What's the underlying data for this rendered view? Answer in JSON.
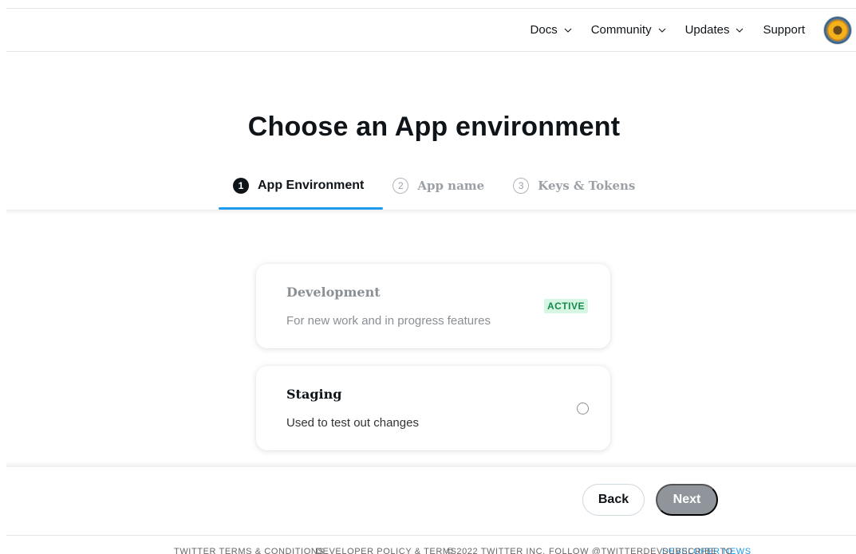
{
  "nav": {
    "items": [
      {
        "label": "Docs",
        "has_dropdown": true
      },
      {
        "label": "Community",
        "has_dropdown": true
      },
      {
        "label": "Updates",
        "has_dropdown": true
      },
      {
        "label": "Support",
        "has_dropdown": false
      }
    ]
  },
  "page_title": "Choose an App environment",
  "steps": [
    {
      "number": "1",
      "label": "App Environment",
      "state": "active"
    },
    {
      "number": "2",
      "label": "App name",
      "state": "inactive"
    },
    {
      "number": "3",
      "label": "Keys & Tokens",
      "state": "inactive"
    }
  ],
  "environments": [
    {
      "title": "Development",
      "description": "For new work and in progress features",
      "badge": "ACTIVE",
      "state": "disabled"
    },
    {
      "title": "Staging",
      "description": "Used to test out changes",
      "selected": false
    }
  ],
  "actions": {
    "back_label": "Back",
    "next_label": "Next"
  },
  "footer": {
    "items": [
      "TWITTER TERMS & CONDITIONS",
      "DEVELOPER POLICY & TERMS",
      "© 2022 TWITTER INC.",
      "FOLLOW @TWITTERDEV"
    ],
    "subscribe_prefix": "SUBSCRIBE TO ",
    "subscribe_link": "DEVELOPER NEWS"
  },
  "colors": {
    "accent": "#1d9bf0",
    "badge_bg": "#d6f5e2",
    "badge_text": "#138a4a",
    "next_button": "#8f959b"
  }
}
